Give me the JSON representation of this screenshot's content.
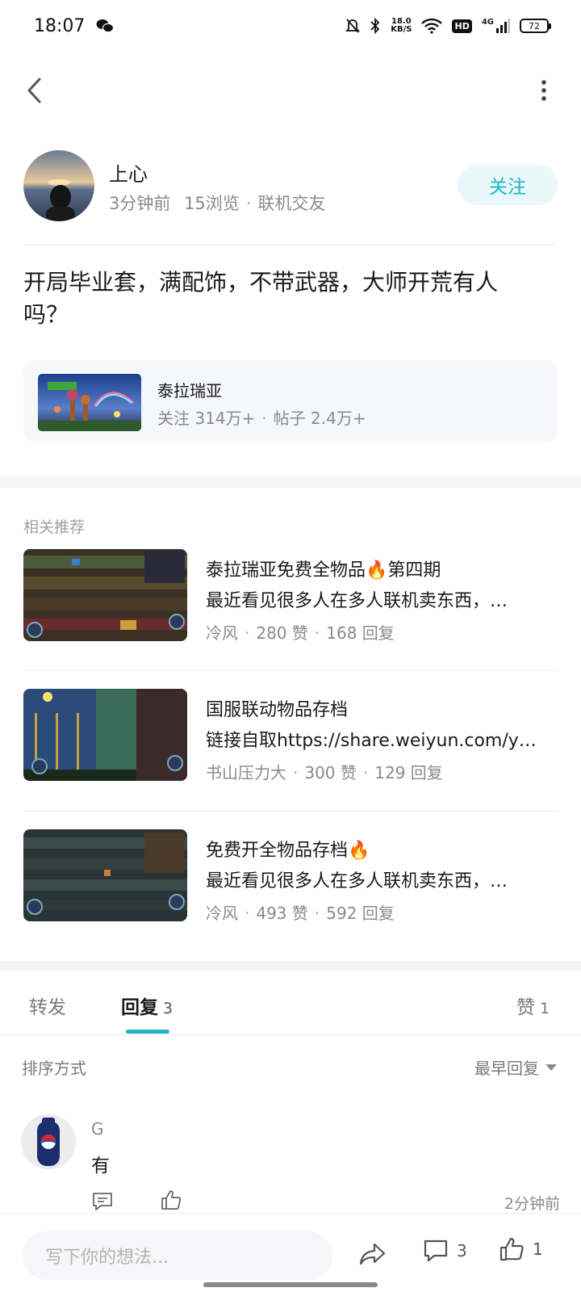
{
  "status_bar": {
    "time": "18:07",
    "net_speed_value": "18.0",
    "net_speed_unit": "KB/S",
    "hd_label": "HD",
    "network_label": "4G",
    "battery": "72"
  },
  "author": {
    "name": "上心",
    "time": "3分钟前",
    "views": "15浏览",
    "category": "联机交友",
    "follow_label": "关注"
  },
  "post": {
    "title": "开局毕业套，满配饰，不带武器，大师开荒有人吗？"
  },
  "game": {
    "name": "泰拉瑞亚",
    "followers": "关注 314万+",
    "posts": "帖子 2.4万+"
  },
  "recommend": {
    "heading": "相关推荐",
    "items": [
      {
        "title": "泰拉瑞亚免费全物品🔥第四期",
        "desc": "最近看见很多人在多人联机卖东西，…",
        "author": "冷风",
        "likes": "280 赞",
        "replies": "168 回复"
      },
      {
        "title": "国服联动物品存档",
        "desc": "链接自取https://share.weiyun.com/y…",
        "author": "书山压力大",
        "likes": "300 赞",
        "replies": "129 回复"
      },
      {
        "title": "免费开全物品存档🔥",
        "desc": "最近看见很多人在多人联机卖东西，…",
        "author": "冷风",
        "likes": "493 赞",
        "replies": "592 回复"
      }
    ]
  },
  "tabs": {
    "forward": "转发",
    "reply": "回复",
    "reply_count": "3",
    "like": "赞",
    "like_count": "1",
    "active": "reply"
  },
  "sort": {
    "label": "排序方式",
    "value": "最早回复"
  },
  "comments": [
    {
      "name": "G",
      "text": "有",
      "time": "2分钟前"
    }
  ],
  "bottom_bar": {
    "placeholder": "写下你的想法...",
    "comment_count": "3",
    "like_count": "1"
  },
  "colors": {
    "accent": "#1fb5c5",
    "follow_bg": "#e8f8fb",
    "band": "#f3f5f9"
  }
}
